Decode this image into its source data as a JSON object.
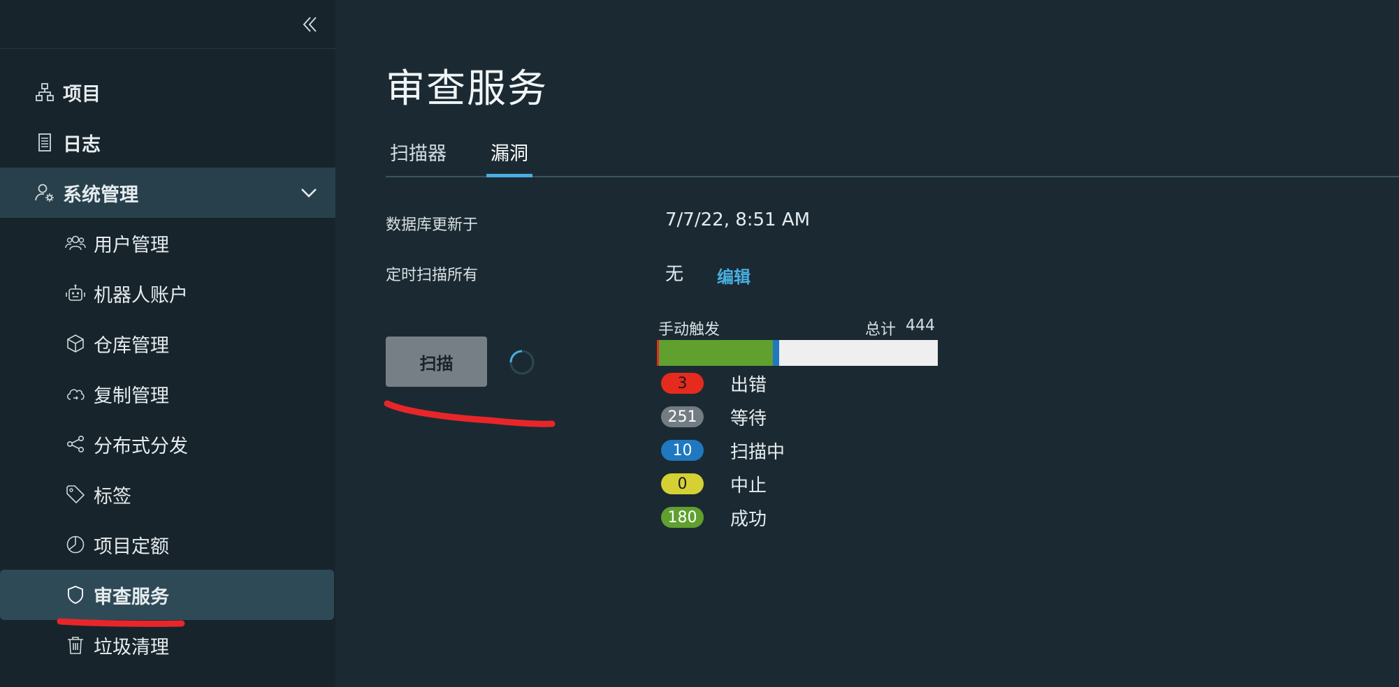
{
  "sidebar": {
    "items": [
      {
        "label": "项目",
        "icon": "project-icon"
      },
      {
        "label": "日志",
        "icon": "log-icon"
      },
      {
        "label": "系统管理",
        "icon": "admin-icon"
      },
      {
        "label": "用户管理",
        "icon": "users-icon"
      },
      {
        "label": "机器人账户",
        "icon": "robot-icon"
      },
      {
        "label": "仓库管理",
        "icon": "cube-icon"
      },
      {
        "label": "复制管理",
        "icon": "cloud-sync-icon"
      },
      {
        "label": "分布式分发",
        "icon": "share-icon"
      },
      {
        "label": "标签",
        "icon": "tag-icon"
      },
      {
        "label": "项目定额",
        "icon": "quota-icon"
      },
      {
        "label": "审查服务",
        "icon": "shield-icon"
      },
      {
        "label": "垃圾清理",
        "icon": "trash-icon"
      }
    ]
  },
  "main": {
    "title": "审查服务",
    "tabs": [
      {
        "label": "扫描器"
      },
      {
        "label": "漏洞"
      }
    ],
    "db_updated_label": "数据库更新于",
    "db_updated_value": "7/7/22, 8:51 AM",
    "schedule_label": "定时扫描所有",
    "schedule_value": "无",
    "edit_label": "编辑",
    "scan_button": "扫描",
    "stats": {
      "trigger_label": "手动触发",
      "total_label": "总计",
      "total_value": "444",
      "items": [
        {
          "count": "3",
          "label": "出错",
          "color": "#e62a1e",
          "text_color": "#1b1b1b"
        },
        {
          "count": "251",
          "label": "等待",
          "color": "#737c83",
          "text_color": "#ffffff"
        },
        {
          "count": "10",
          "label": "扫描中",
          "color": "#1f78c0",
          "text_color": "#ffffff"
        },
        {
          "count": "0",
          "label": "中止",
          "color": "#d5d034",
          "text_color": "#1b1b1b"
        },
        {
          "count": "180",
          "label": "成功",
          "color": "#5fa02f",
          "text_color": "#ffffff"
        }
      ]
    }
  },
  "colors": {
    "accent": "#49aee0",
    "annotation": "#e8262a"
  }
}
